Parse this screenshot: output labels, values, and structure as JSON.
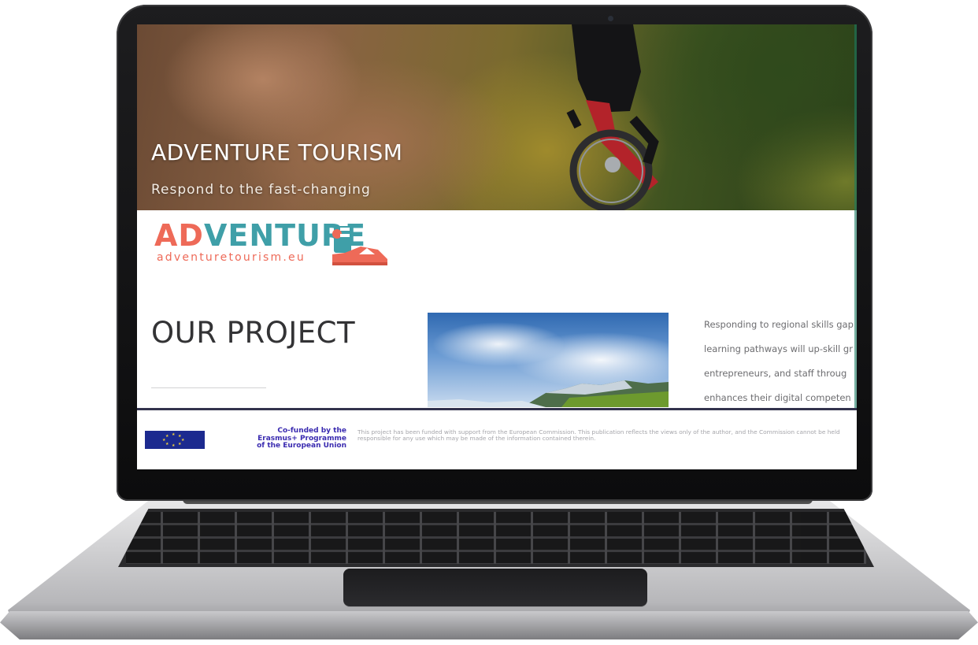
{
  "hero": {
    "title": "ADVENTURE TOURISM",
    "subtitle": "Respond to the fast-changing"
  },
  "logo": {
    "prefix": "AD",
    "suffix": "VENTURE",
    "url": "adventuretourism.eu"
  },
  "project": {
    "title": "OUR PROJECT",
    "description_lines": [
      "Responding to regional skills gap",
      "learning pathways will up-skill gr",
      "entrepreneurs, and staff throug",
      "enhances their digital competen"
    ]
  },
  "footer": {
    "cofunded_text": "Co-funded by the\nErasmus+ Programme\nof the European Union",
    "disclaimer": "This project has been funded with support from the European Commission. This publication reflects the views only of the author, and the Commission cannot be held responsible for any use which may be made of the information contained therein."
  },
  "colors": {
    "logo_coral": "#ee6a58",
    "logo_teal": "#3f9fa8",
    "eu_blue": "#1c2a8f",
    "eu_star": "#f1d13a",
    "divider": "#33334d"
  }
}
